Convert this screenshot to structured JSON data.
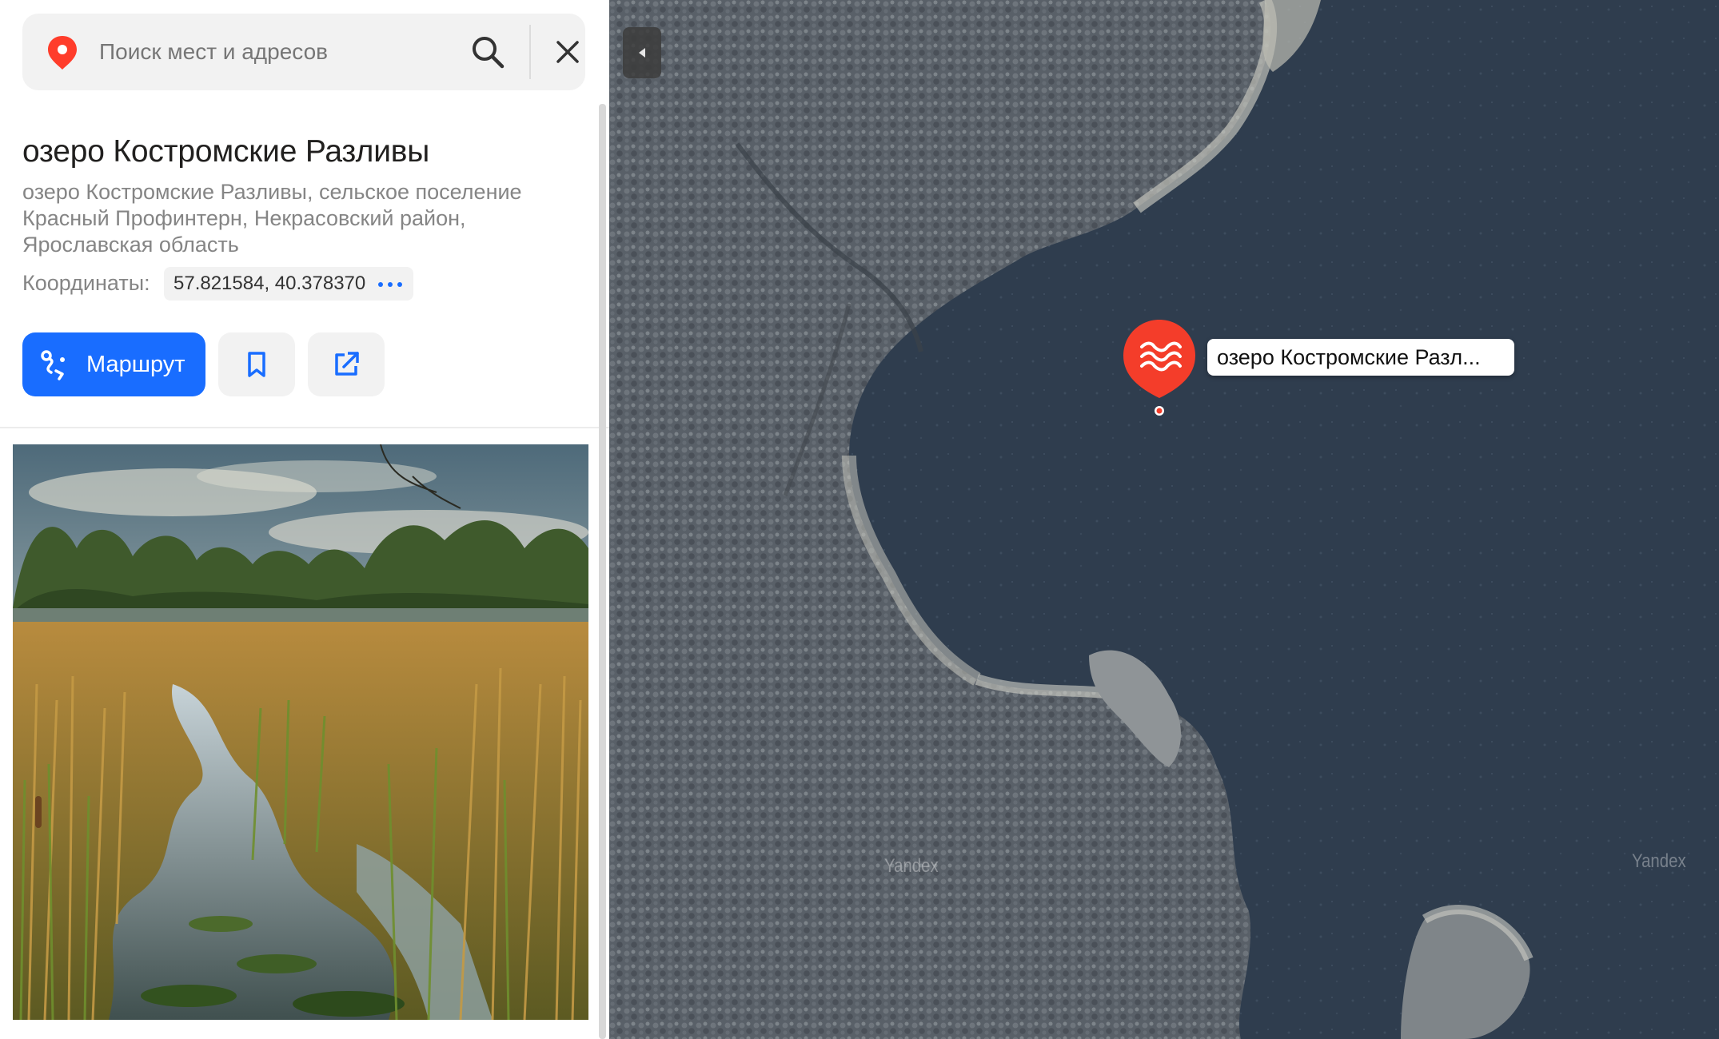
{
  "search": {
    "placeholder": "Поиск мест и адресов"
  },
  "place": {
    "title": "озеро Костромские Разливы",
    "address": "озеро Костромские Разливы, сельское поселение Красный Профинтерн, Некрасовский район, Ярославская область",
    "coords_label": "Координаты:",
    "coords_value": "57.821584, 40.378370"
  },
  "actions": {
    "route_label": "Маршрут"
  },
  "map": {
    "marker_label": "озеро Костромские Разл...",
    "watermark_1": "Yandex",
    "watermark_2": "Yandex"
  },
  "colors": {
    "accent_blue": "#196dff",
    "marker_red": "#f43d2a",
    "pin_red": "#ff3d2b"
  },
  "icons": {
    "search_pin": "location-pin-icon",
    "search": "search-icon",
    "close": "close-icon",
    "more": "more-dots-icon",
    "route": "route-icon",
    "bookmark": "bookmark-icon",
    "share": "share-icon",
    "collapse": "collapse-arrow-icon",
    "marker": "water-waves-icon"
  }
}
